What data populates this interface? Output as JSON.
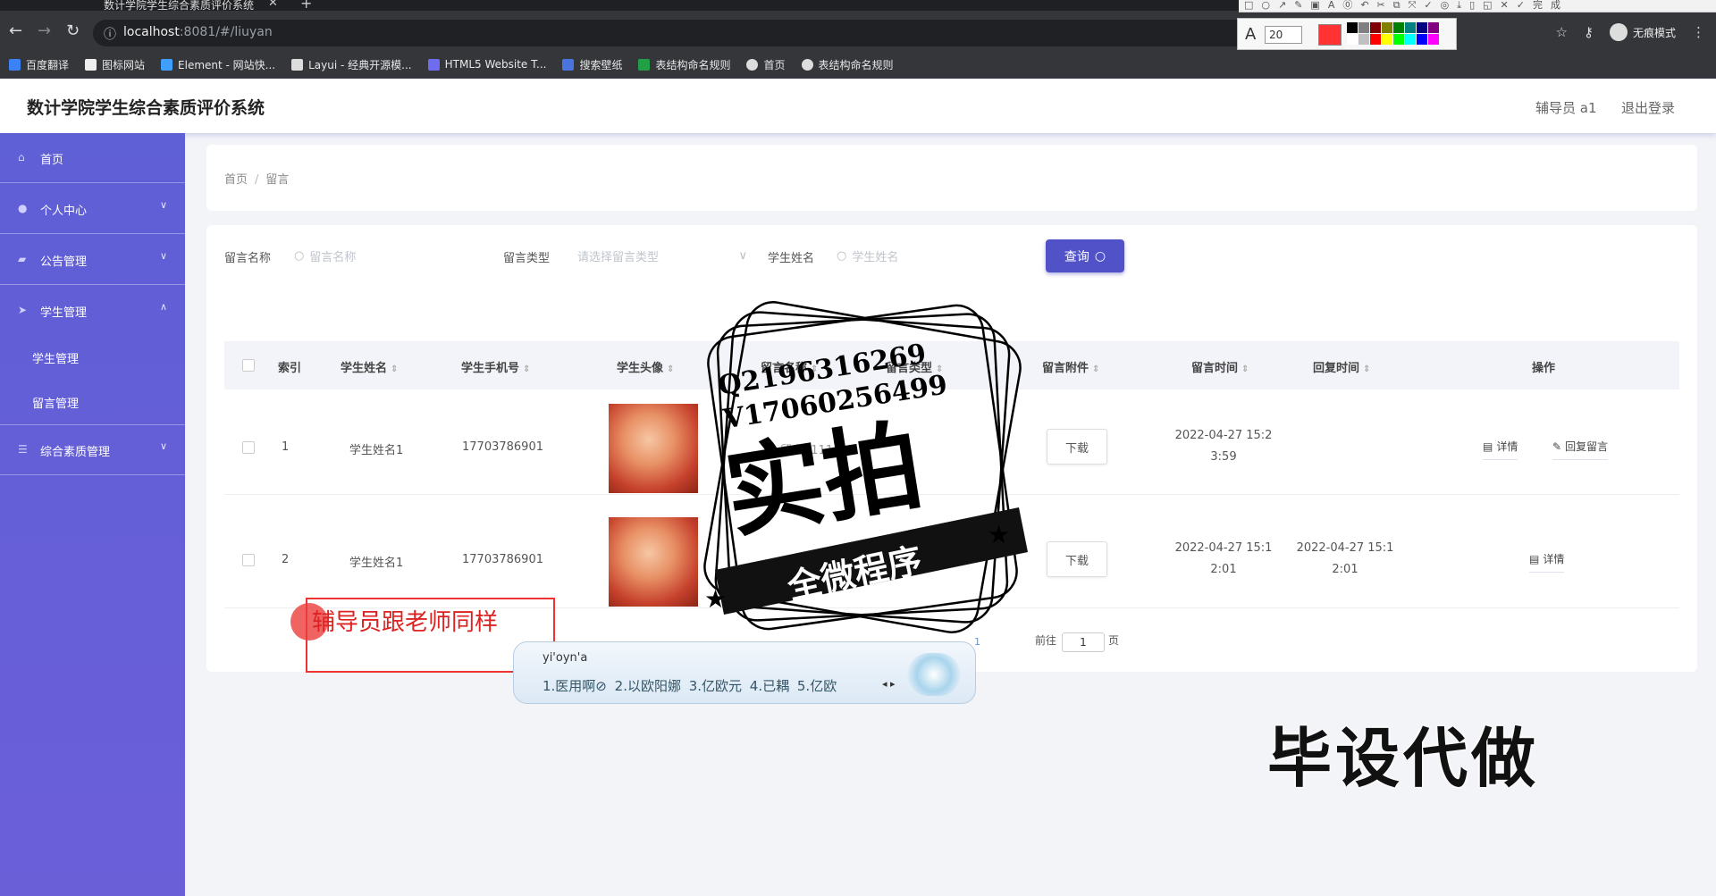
{
  "browser": {
    "tab_title": "数计学院学生综合素质评价系统",
    "url_host": "localhost",
    "url_path": ":8081/#/liuyan",
    "incognito_label": "无痕模式",
    "bookmarks": [
      "百度翻译",
      "图标网站",
      "Element - 网站快...",
      "Layui - 经典开源模...",
      "HTML5 Website T...",
      "搜索壁纸",
      "表结构命名规则",
      "首页",
      "表结构命名规则"
    ]
  },
  "annotation_toolbar": {
    "top_icons": "□○↗✎▣A⓪↶✂⧉⤧✓◎⤓▯◱✕✓完成",
    "font_size": "20",
    "current_color": "#ff3333",
    "swatches": [
      "#000000",
      "#808080",
      "#800000",
      "#808000",
      "#008000",
      "#008080",
      "#000080",
      "#800080",
      "#ffffff",
      "#c0c0c0",
      "#ff0000",
      "#ffff00",
      "#00ff00",
      "#00ffff",
      "#0000ff",
      "#ff00ff"
    ]
  },
  "app": {
    "title": "数计学院学生综合素质评价系统",
    "user_role": "辅导员 a1",
    "logout": "退出登录"
  },
  "sidebar": {
    "items": [
      {
        "label": "首页",
        "icon": "home-icon"
      },
      {
        "label": "个人中心",
        "icon": "user-icon"
      },
      {
        "label": "公告管理",
        "icon": "notice-icon"
      },
      {
        "label": "学生管理",
        "icon": "send-icon"
      },
      {
        "label": "综合素质管理",
        "icon": "list-icon"
      }
    ],
    "sub_items": [
      "学生管理",
      "留言管理"
    ]
  },
  "breadcrumb": {
    "home": "首页",
    "current": "留言"
  },
  "filters": {
    "name_label": "留言名称",
    "name_placeholder": "留言名称",
    "type_label": "留言类型",
    "type_placeholder": "请选择留言类型",
    "student_label": "学生姓名",
    "student_placeholder": "学生姓名",
    "search_button": "查询"
  },
  "table": {
    "headers": [
      "索引",
      "学生姓名",
      "学生手机号",
      "学生头像",
      "留言名称",
      "留言类型",
      "留言附件",
      "留言时间",
      "回复时间",
      "操作"
    ],
    "rows": [
      {
        "index": "1",
        "student_name": "学生姓名1",
        "phone": "17703786901",
        "download": "下载",
        "msg_time_1": "2022-04-27 15:2",
        "msg_time_2": "3:59",
        "reply_time_1": "",
        "reply_time_2": "",
        "detail": "详情",
        "reply": "回复留言",
        "partial_name": "留言1111"
      },
      {
        "index": "2",
        "student_name": "学生姓名1",
        "phone": "17703786901",
        "download": "下载",
        "msg_time_1": "2022-04-27 15:1",
        "msg_time_2": "2:01",
        "reply_time_1": "2022-04-27 15:1",
        "reply_time_2": "2:01",
        "detail": "详情"
      }
    ]
  },
  "pager": {
    "current": "1",
    "goto": "前往",
    "page_value": "1",
    "page_unit": "页"
  },
  "overlays": {
    "annotation_text": "辅导员跟老师同样",
    "ime_input": "yi'oyn'a",
    "ime_candidates": "1.医用啊⊘  2.以欧阳娜  3.亿欧元  4.已耦  5.亿欧",
    "stamp_qq": "Q2196316269",
    "stamp_v": "V17060256499",
    "stamp_main": "实拍",
    "stamp_banner": "全微程序",
    "corner_text": "毕设代做"
  }
}
